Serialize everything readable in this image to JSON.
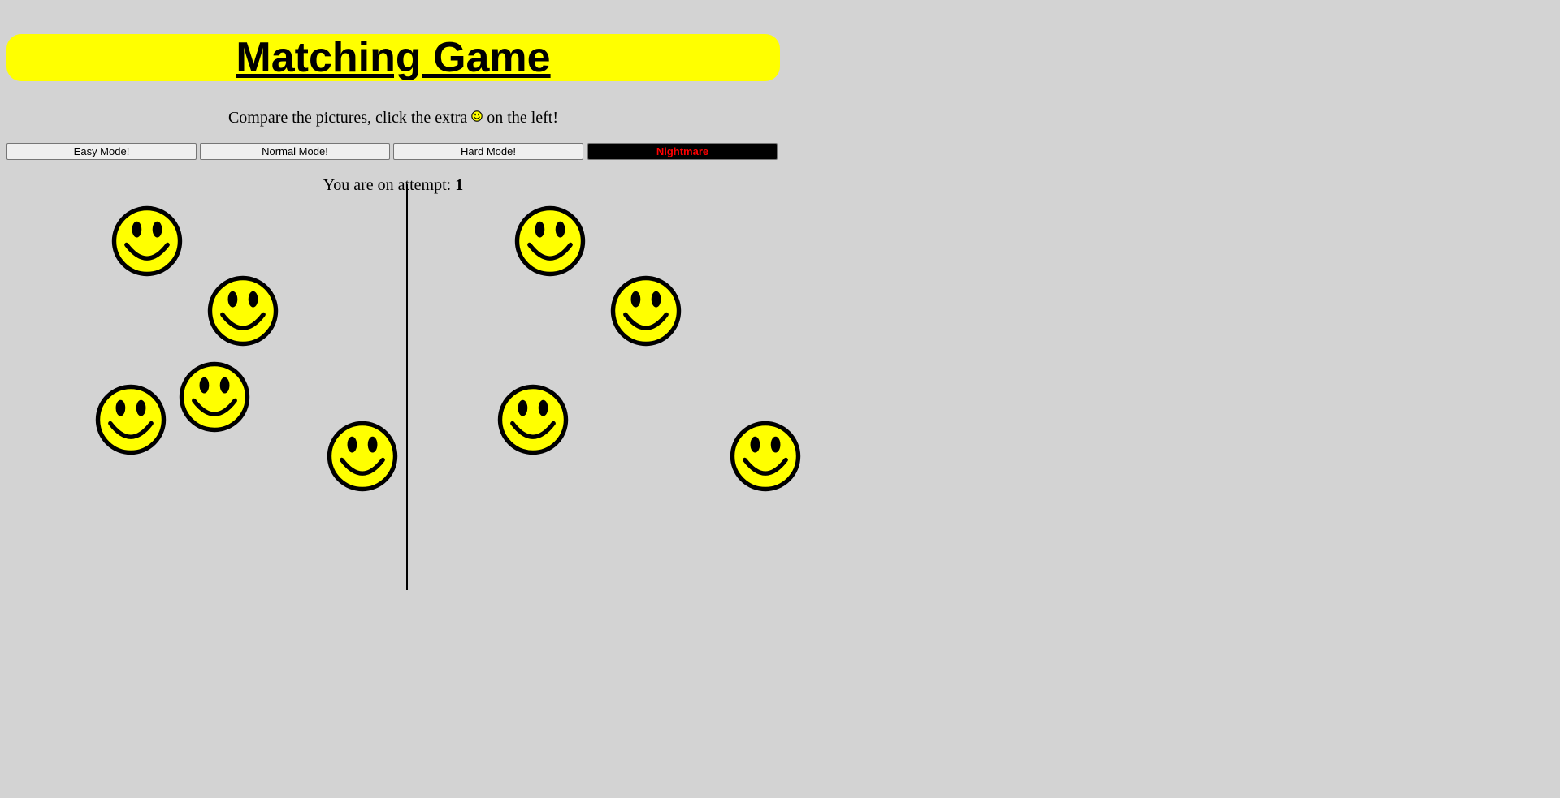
{
  "header": {
    "title": "Matching Game"
  },
  "instructions": {
    "prefix": "Compare the pictures, click the extra",
    "icon": "smiley-face",
    "suffix": "on the left!"
  },
  "modes": [
    {
      "label": "Easy Mode!"
    },
    {
      "label": "Normal Mode!"
    },
    {
      "label": "Hard Mode!"
    },
    {
      "label": "Nightmare"
    }
  ],
  "status": {
    "attempt_label": "You are on attempt:",
    "attempt_number": "1"
  },
  "board": {
    "left_faces": 5,
    "right_faces": 4
  },
  "colors": {
    "background": "#d3d3d3",
    "banner": "#ffff00",
    "face_fill": "#ffff00",
    "nightmare_bg": "#000000",
    "nightmare_text": "#ff0000"
  }
}
